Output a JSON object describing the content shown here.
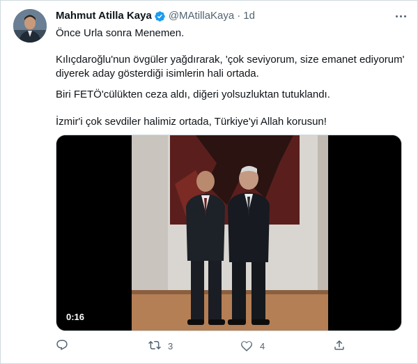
{
  "tweet": {
    "author_name": "Mahmut Atilla Kaya",
    "author_handle": "@MAtillaKaya",
    "separator": "·",
    "time": "1d",
    "lines": [
      "Önce Urla sonra Menemen.",
      "Kılıçdaroğlu'nun övgüler yağdırarak, 'çok seviyorum, size emanet ediyorum'",
      "diyerek aday gösterdiği isimlerin hali ortada.",
      "Biri FETÖ'cülükten ceza aldı, diğeri yolsuzluktan tutuklandı.",
      "İzmir'i çok sevdiler halimiz ortada, Türkiye'yi Allah korusun!"
    ],
    "video": {
      "duration": "0:16"
    },
    "actions": {
      "reply_count": "",
      "retweet_count": "3",
      "like_count": "4"
    }
  },
  "icons": {
    "verified": "verified-badge-icon",
    "more": "more-icon",
    "reply": "reply-icon",
    "retweet": "retweet-icon",
    "like": "heart-icon",
    "share": "share-icon"
  },
  "colors": {
    "text": "#0f1419",
    "secondary": "#536471",
    "verified": "#1d9bf0",
    "border": "#cfd9de"
  }
}
